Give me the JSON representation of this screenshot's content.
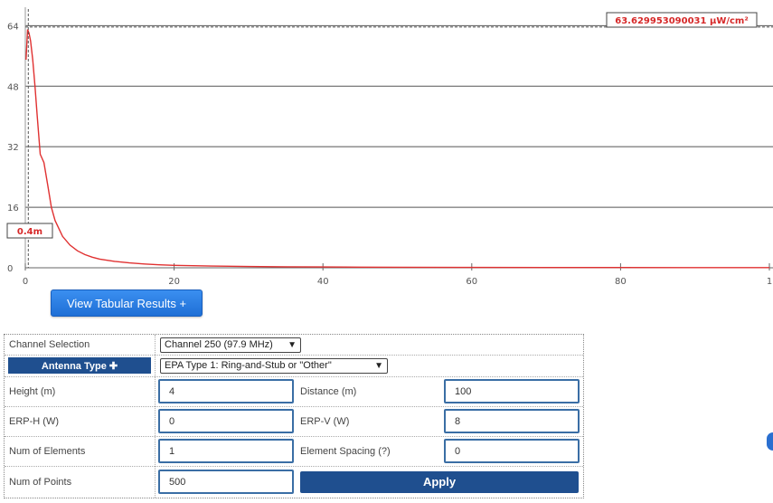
{
  "chart_data": {
    "type": "line",
    "y_ticks": [
      "0",
      "16",
      "32",
      "48",
      "64"
    ],
    "x_ticks": [
      "0",
      "20",
      "40",
      "60",
      "80",
      "1"
    ],
    "ylim": [
      0,
      66
    ],
    "xlim": [
      0,
      100
    ],
    "grid": "horizontal",
    "series": [
      {
        "color": "#e03131",
        "x": [
          0.1,
          0.3,
          0.5,
          0.7,
          1,
          1.3,
          1.6,
          2,
          2.5,
          3,
          3.5,
          4,
          5,
          6,
          7,
          8,
          9,
          10,
          12,
          14,
          16,
          18,
          20,
          25,
          30,
          35,
          40,
          45,
          50,
          60,
          70,
          80,
          90,
          100
        ],
        "values": [
          55,
          63,
          62,
          60,
          55,
          48,
          40,
          30,
          27.8,
          22,
          16,
          12.5,
          8.3,
          6,
          4.5,
          3.5,
          2.8,
          2.3,
          1.7,
          1.3,
          1.0,
          0.8,
          0.65,
          0.45,
          0.33,
          0.26,
          0.21,
          0.17,
          0.14,
          0.1,
          0.08,
          0.06,
          0.05,
          0.04
        ]
      }
    ],
    "marker_x": 0.4,
    "marker_x_label": "0.4m",
    "marker_y_label": "63.629953090031 µW/cm²",
    "marker_y": 63.63
  },
  "view_button": "View Tabular Results +",
  "form": {
    "channel_label": "Channel Selection",
    "channel_value": "Channel 250 (97.9 MHz)",
    "antenna_button": "Antenna Type ✚",
    "antenna_value": "EPA Type 1: Ring-and-Stub or \"Other\"",
    "height_label": "Height (m)",
    "height_value": "4",
    "distance_label": "Distance (m)",
    "distance_value": "100",
    "erph_label": "ERP-H (W)",
    "erph_value": "0",
    "erpv_label": "ERP-V (W)",
    "erpv_value": "8",
    "elements_label": "Num of Elements",
    "elements_value": "1",
    "spacing_label": "Element Spacing (?)",
    "spacing_value": "0",
    "points_label": "Num of Points",
    "points_value": "500",
    "apply_label": "Apply"
  }
}
